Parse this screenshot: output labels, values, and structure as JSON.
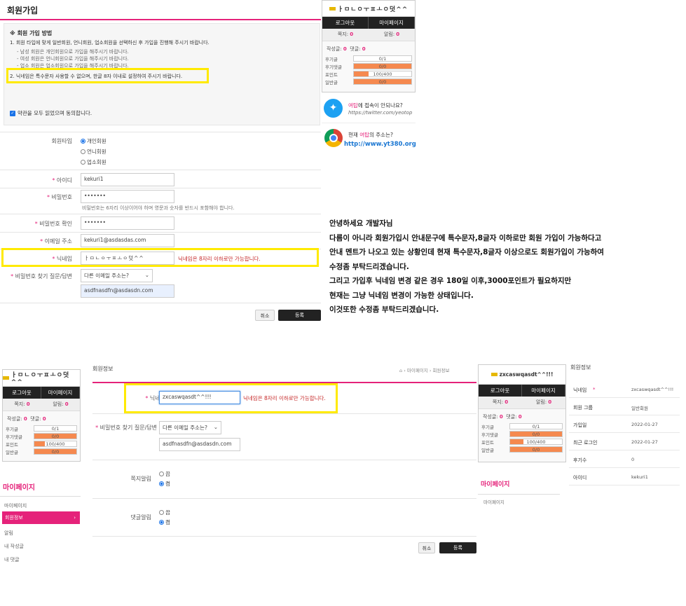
{
  "top": {
    "title": "회원가입",
    "guide_title": "※ 회원 가입 방법",
    "guide_1": "1. 회원 타입에 맞게 일반회원, 언니회원, 업소회원을 선택하신 후 가입을 진행해 주시기 바랍니다.",
    "guide_1_sub": [
      "- 남성 회원은 개인회원으로 가입을 해주시기 바랍니다.",
      "- 여성 회원은 언니회원으로 가입을 해주시기 바랍니다.",
      "- 업소 회원은 업소회원으로 가입을 해주시기 바랍니다."
    ],
    "guide_2": "2. 닉네임은 특수문자 사용할 수 없으며, 한글 8자 이내로 설정하여 주시기 바랍니다.",
    "agree_label": "약관을 모두 읽었으며 동의합니다.",
    "member_type_label": "회원타입",
    "member_types": [
      "개인회원",
      "언니회원",
      "업소회원"
    ],
    "id_label": "아이디",
    "id_value": "kekuri1",
    "pw_label": "비밀번호",
    "pw_value": "•••••••",
    "pw_help": "비밀번호는 6자리 이상이어야 하며 영문과 숫자를 반드시 포함해야 합니다.",
    "pw_confirm_label": "비밀번호 확인",
    "pw_confirm_value": "•••••••",
    "email_label": "이메일 주소",
    "email_value": "kekuri1@asdasdas.com",
    "nick_label": "닉네임",
    "nick_value": "ㅏㅁㄴㅇㅜㅍㅗㅇ덧^^",
    "nick_warning": "닉네임은 8자리 이하로만 가능합니다.",
    "pwq_label": "비밀번호 찾기 질문/답변",
    "pwq_select": "다른 이메일 주소는?",
    "pwq_answer": "asdfnasdfn@asdasdn.com",
    "cancel": "취소",
    "submit": "등록"
  },
  "widget_top": {
    "nick": "ㅏㅁㄴㅇㅜㅍㅗㅇ덧^^",
    "logout": "로그아웃",
    "mypage": "마이페이지",
    "note_label": "쪽지:",
    "note_val": "0",
    "alarm_label": "알림:",
    "alarm_val": "0",
    "posts_label": "작성글:",
    "posts_val": "0",
    "comments_label": "댓글:",
    "comments_val": "0",
    "rows": [
      {
        "k": "후기글",
        "v": "0/1",
        "pct": 0
      },
      {
        "k": "후기댓글",
        "v": "0/0",
        "pct": 100
      },
      {
        "k": "포인트",
        "v": "100/400",
        "pct": 25
      },
      {
        "k": "일반글",
        "v": "0/0",
        "pct": 100
      }
    ]
  },
  "promo": {
    "twitter_prefix": "여탑",
    "twitter_line": "에 접속이 안되나요?",
    "twitter_url": "https://twitter.com/yeotop",
    "chrome_prefix": "현재 ",
    "chrome_brand": "여탑",
    "chrome_suffix": "의 주소는?",
    "chrome_url": "http://www.yt380.org"
  },
  "message": [
    "안녕하세요 개발자님",
    "다름이 아니라 회원가입시 안내문구에 특수문자,8글자 이하로만 회원 가입이 가능하다고",
    "안내 멘트가 나오고 있는 상황인데 현재 특수문자,8글자 이상으로도 회원가입이 가능하여",
    "수정좀 부탁드리겠습니다.",
    "그리고 가입후 닉네임 변경 같은 경우 180일 이후,3000포인트가 필요하지만",
    "현재는 그냥 닉네임 변경이 가능한 상태입니다.",
    "이것또한 수정좀 부탁드리겠습니다."
  ],
  "bottom": {
    "widget_nick": "ㅏㅁㄴㅇㅜㅍㅗㅇ덧^^",
    "section_title": "회원정보",
    "breadcrumb": [
      "마이페이지",
      "회원정보"
    ],
    "nick_label": "닉네임",
    "nick_value": "zxcaswqasdt^^!!!",
    "nick_warning": "닉네임은 8자리 이하로만 가능합니다.",
    "pwq_label": "비밀번호 찾기 질문/답변",
    "pwq_select": "다른 이메일 주소는?",
    "pwq_answer": "asdfnasdfn@asdasdn.com",
    "note_alarm_label": "쪽지알림",
    "comment_alarm_label": "댓글알림",
    "radio_yes": "끔",
    "radio_no": "켬",
    "cancel": "취소",
    "submit": "등록",
    "mypage_title": "마이페이지",
    "menu": [
      "마이페이지",
      "회원정보",
      "알림",
      "내 작성글",
      "내 댓글"
    ],
    "widget2_nick": "zxcaswqasdt^^!!!",
    "mypage_title2": "마이페이지",
    "menu2_first": "마이페이지",
    "info_title": "회원정보",
    "info": [
      {
        "k": "닉네임",
        "v": "zxcaswqasdt^^!!!",
        "req": true
      },
      {
        "k": "회원 그룹",
        "v": "일반회원",
        "req": false
      },
      {
        "k": "가입일",
        "v": "2022-01-27",
        "req": false
      },
      {
        "k": "최근 로그인",
        "v": "2022-01-27",
        "req": false
      },
      {
        "k": "후기수",
        "v": "0",
        "req": false
      },
      {
        "k": "아이디",
        "v": "kekuri1",
        "req": false
      }
    ]
  },
  "colors": {
    "accent": "#e5227a",
    "highlight": "#ffea00",
    "bar": "#f5894f",
    "link": "#1a73e8"
  }
}
